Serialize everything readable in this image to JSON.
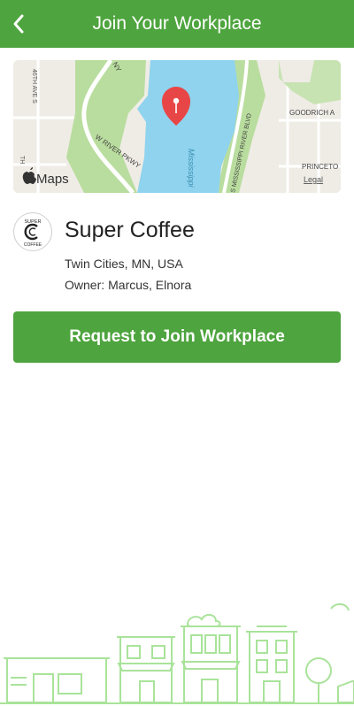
{
  "header": {
    "title": "Join Your Workplace",
    "back_icon": "chevron-left-icon"
  },
  "map": {
    "provider_label": "Maps",
    "legal_label": "Legal",
    "water_label": "Mississippi",
    "streets": [
      "46TH AVE S",
      "W RIVER PKWY",
      "S MISSISSIPPI RIVER BLVD",
      "GOODRICH A",
      "PRINCETO",
      "NY",
      "TH"
    ],
    "pin_icon": "map-pin-icon"
  },
  "company": {
    "name": "Super Coffee",
    "logo_top_text": "SUPER",
    "logo_bottom_text": "COFFEE",
    "location": "Twin Cities, MN, USA",
    "owner_label": "Owner:",
    "owner_value": "Marcus, Elnora"
  },
  "actions": {
    "join_label": "Request to Join Workplace"
  },
  "colors": {
    "brand_green": "#4ea43e",
    "map_water": "#8fd3ee",
    "map_park": "#b9dd9e",
    "pin_red": "#e84646"
  }
}
